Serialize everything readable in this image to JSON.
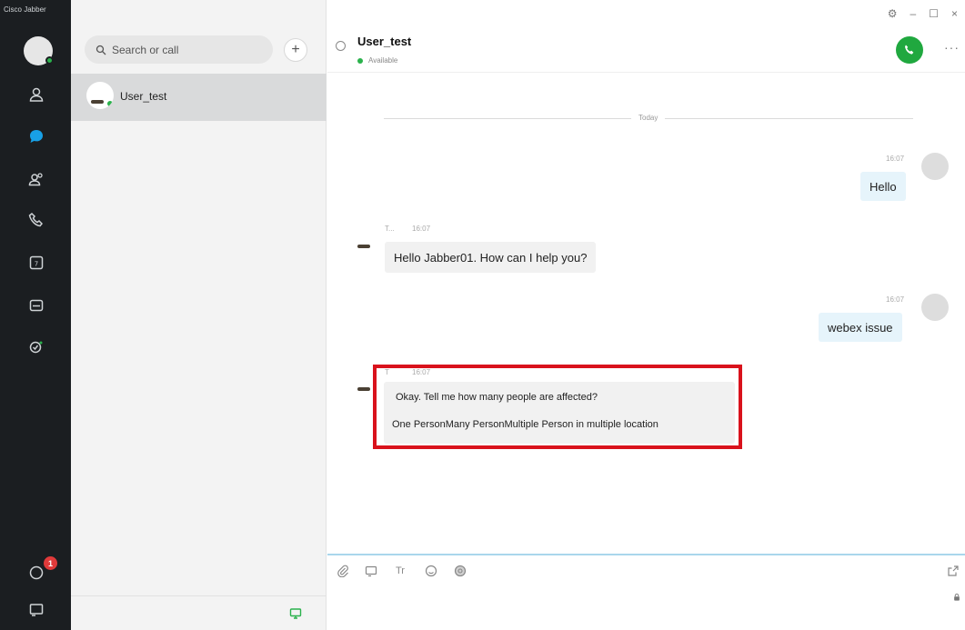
{
  "app": {
    "title": "Cisco Jabber"
  },
  "rail": {
    "notification_count": "1"
  },
  "search": {
    "placeholder": "Search or call"
  },
  "contacts": [
    {
      "name": "User_test"
    }
  ],
  "window_controls": {
    "settings": "⚙",
    "minimize": "–",
    "maximize": "☐",
    "close": "×"
  },
  "chat": {
    "contact_name": "User_test",
    "status": "Available",
    "more_label": "···",
    "day_label": "Today",
    "messages": [
      {
        "direction": "out",
        "time": "16:07",
        "text": "Hello"
      },
      {
        "direction": "in",
        "sender": "T...",
        "time": "16:07",
        "text": "Hello Jabber01. How can I help you?"
      },
      {
        "direction": "out",
        "time": "16:07",
        "text": "webex issue"
      },
      {
        "direction": "in",
        "sender": "T",
        "time": "16:07",
        "text": "Okay. Tell me how many people are affected?",
        "options": "One PersonMany PersonMultiple Person in multiple location"
      }
    ]
  },
  "composer": {
    "format_label": "Tr"
  },
  "colors": {
    "accent_call": "#20a83f",
    "highlight": "#d9121c",
    "presence": "#2bb24c",
    "rail_bg": "#1b1e21"
  }
}
